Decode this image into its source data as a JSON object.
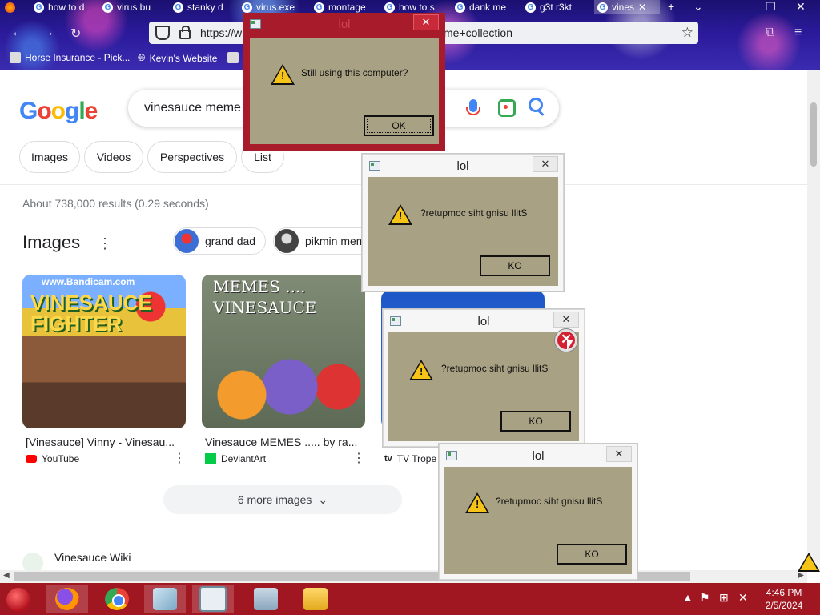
{
  "browser": {
    "tabs": [
      {
        "label": "how to d",
        "active": false
      },
      {
        "label": "virus bu",
        "active": false
      },
      {
        "label": "stanky d",
        "active": false
      },
      {
        "label": "virus.exe",
        "active": false
      },
      {
        "label": "montage",
        "active": false
      },
      {
        "label": "how to s",
        "active": false
      },
      {
        "label": "dank me",
        "active": false
      },
      {
        "label": "g3t r3kt",
        "active": false
      },
      {
        "label": "vines",
        "active": true
      }
    ],
    "url_prefix": "https://w",
    "url_suffix": "me+collection",
    "bookmarks": [
      {
        "label": "Horse Insurance - Pick..."
      },
      {
        "label": "Kevin's Website"
      }
    ]
  },
  "google": {
    "logo": "Google",
    "query": "vinesauce meme",
    "chips": [
      "Images",
      "Videos",
      "Perspectives",
      "List"
    ],
    "stats": "About 738,000 results (0.29 seconds)",
    "images_heading": "Images",
    "related": [
      "grand dad",
      "pikmin mem"
    ],
    "thumbs": [
      {
        "overlay": "VINESAUCE FIGHTER",
        "watermark": "www.Bandicam.com",
        "caption": "[Vinesauce] Vinny - Vinesau...",
        "source": "YouTube"
      },
      {
        "overlay": "MEMES .... VINESAUCE",
        "caption": "Vinesauce MEMES ..... by ra...",
        "source": "DeviantArt"
      },
      {
        "caption": "",
        "source": "TV Trope"
      }
    ],
    "more_images": "6 more images",
    "wiki_title": "Vinesauce Wiki"
  },
  "dialogs": {
    "main": {
      "title": "lol",
      "message": "Still using this computer?",
      "ok": "OK"
    },
    "reversed": [
      {
        "title": "lol",
        "message": "?retupmoc siht gnisu llitS",
        "ok": "KO"
      },
      {
        "title": "lol",
        "message": "?retupmoc siht gnisu llitS",
        "ok": "KO"
      },
      {
        "title": "lol",
        "message": "?retupmoc siht gnisu llitS",
        "ok": "KO"
      }
    ]
  },
  "taskbar": {
    "time": "4:46 PM",
    "date": "2/5/2024"
  },
  "icons": {
    "warning": "warning-triangle-icon",
    "error": "error-x-icon",
    "close": "close-icon"
  },
  "colors": {
    "taskbar": "#a01722",
    "dialog_body": "#a9a183",
    "red_dialog_frame": "#a81b2a"
  }
}
